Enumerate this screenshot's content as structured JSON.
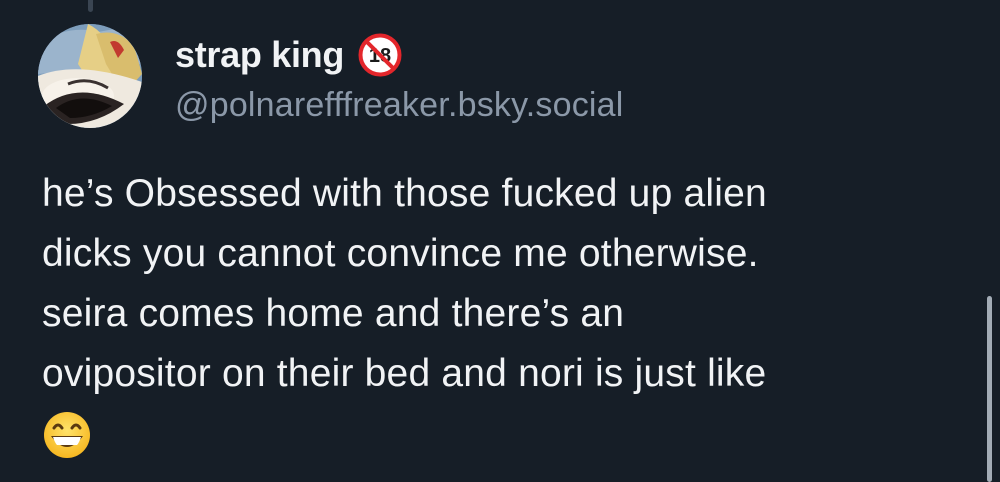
{
  "post": {
    "author": {
      "display_name": "strap king",
      "badge_text": "18",
      "badge_icon": "no-under-18-icon",
      "handle": "@polnarefffreaker.bsky.social"
    },
    "body_lines": [
      "he’s Obsessed with those fucked up alien",
      "dicks you cannot convince me otherwise.",
      "seira comes home and there’s an",
      "ovipositor on their bed and nori is just like"
    ],
    "emoji": "grinning-face-emoji"
  },
  "colors": {
    "background": "#161e27",
    "text": "#f1f3f5",
    "handle": "#8b98a8",
    "badge_red": "#e3262b"
  }
}
